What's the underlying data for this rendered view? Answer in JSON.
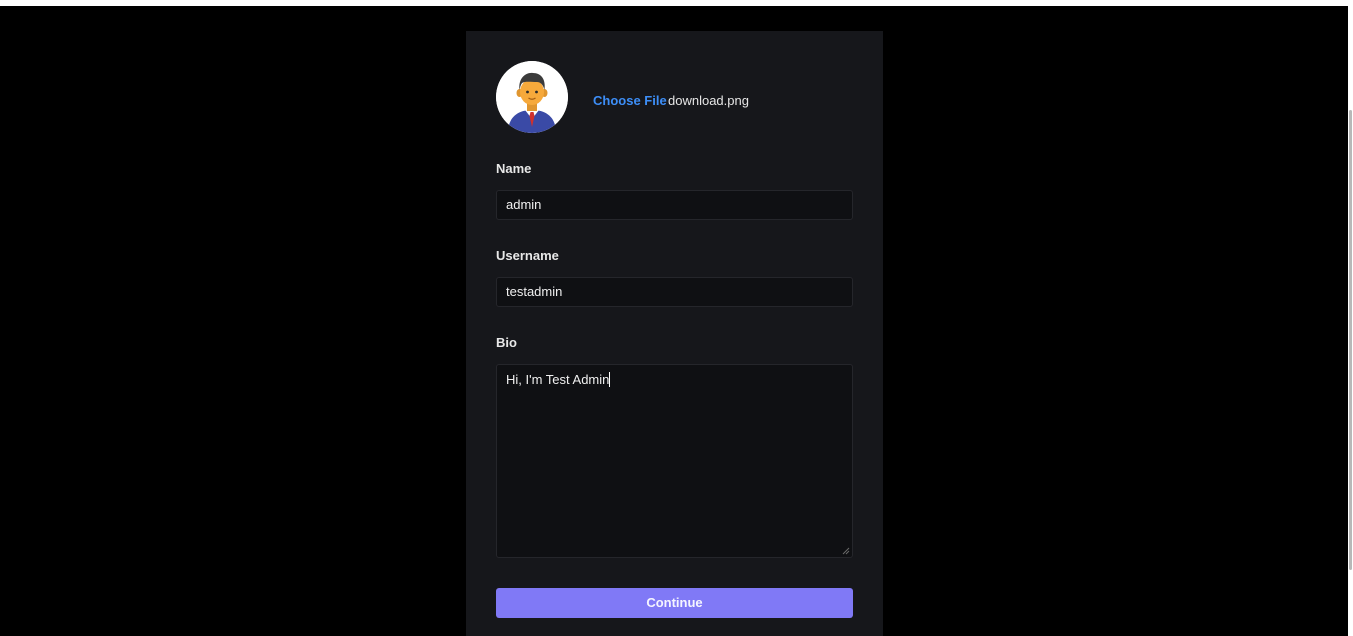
{
  "profile_form": {
    "avatar": {
      "icon": "user-avatar-icon",
      "background_color": "#ffffff",
      "suit_color": "#3a4aa6",
      "skin_color": "#f6a93b",
      "hair_color": "#3b3b3b",
      "tie_color": "#d0312d"
    },
    "file_picker": {
      "button_label": "Choose File",
      "file_name": "download.png",
      "button_color": "#3d8ef7"
    },
    "name": {
      "label": "Name",
      "value": "admin"
    },
    "username": {
      "label": "Username",
      "value": "testadmin"
    },
    "bio": {
      "label": "Bio",
      "value": "Hi, I'm Test Admin"
    },
    "submit": {
      "label": "Continue",
      "color": "#8079f6"
    }
  },
  "theme": {
    "page_background": "#000000",
    "card_background": "#16171b",
    "input_background": "#0f1013"
  }
}
